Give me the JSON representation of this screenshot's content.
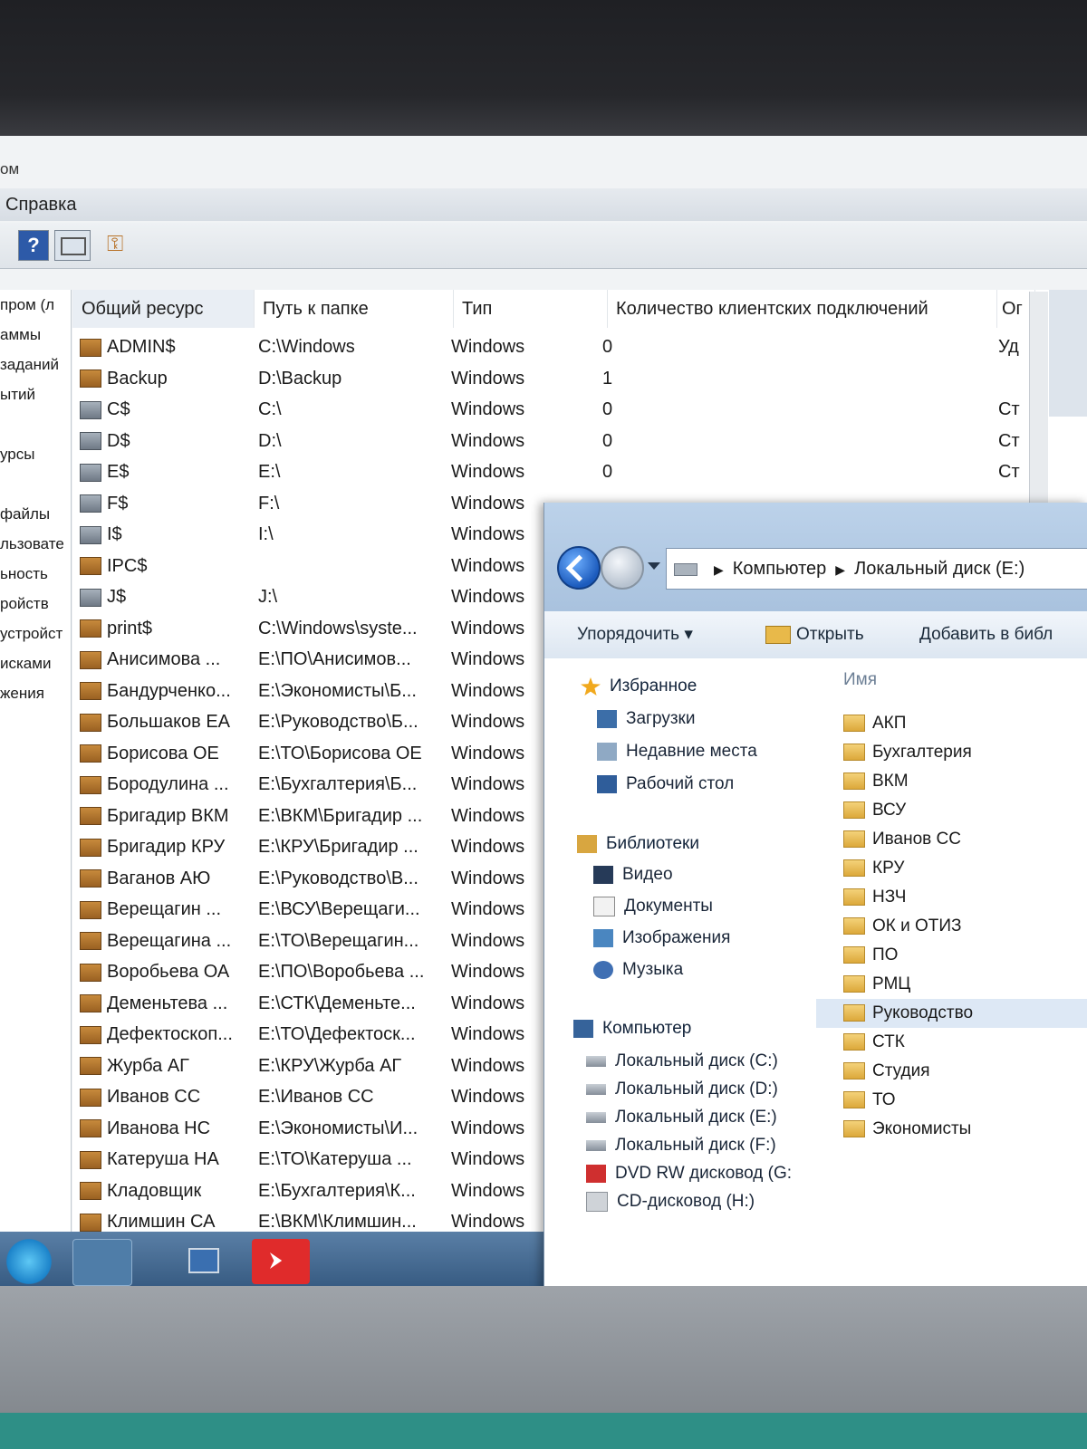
{
  "mmc": {
    "title_fragment": "ом",
    "menu_help": "Справка",
    "tree_items": [
      "пром (л",
      "аммы",
      "заданий",
      "ытий",
      "",
      "урсы",
      "",
      "файлы",
      "льзовате",
      "ьность",
      "ройств",
      "устройст",
      "исками",
      "жения"
    ],
    "columns": {
      "share": "Общий ресурс",
      "path": "Путь к папке",
      "type": "Тип",
      "clients": "Количество клиентских подключений",
      "desc": "Ог"
    },
    "rows": [
      {
        "name": "ADMIN$",
        "path": "C:\\Windows",
        "type": "Windows",
        "clients": "0",
        "desc": "Уд",
        "icon": "share-icon"
      },
      {
        "name": "Backup",
        "path": "D:\\Backup",
        "type": "Windows",
        "clients": "1",
        "desc": "",
        "icon": "share-icon"
      },
      {
        "name": "C$",
        "path": "C:\\",
        "type": "Windows",
        "clients": "0",
        "desc": "Ст",
        "icon": "drive-share-icon"
      },
      {
        "name": "D$",
        "path": "D:\\",
        "type": "Windows",
        "clients": "0",
        "desc": "Ст",
        "icon": "drive-share-icon"
      },
      {
        "name": "E$",
        "path": "E:\\",
        "type": "Windows",
        "clients": "0",
        "desc": "Ст",
        "icon": "drive-share-icon"
      },
      {
        "name": "F$",
        "path": "F:\\",
        "type": "Windows",
        "clients": "",
        "desc": "",
        "icon": "drive-share-icon"
      },
      {
        "name": "I$",
        "path": "I:\\",
        "type": "Windows",
        "clients": "",
        "desc": "",
        "icon": "drive-share-icon"
      },
      {
        "name": "IPC$",
        "path": "",
        "type": "Windows",
        "clients": "",
        "desc": "",
        "icon": "share-icon"
      },
      {
        "name": "J$",
        "path": "J:\\",
        "type": "Windows",
        "clients": "",
        "desc": "",
        "icon": "drive-share-icon"
      },
      {
        "name": "print$",
        "path": "C:\\Windows\\syste...",
        "type": "Windows",
        "clients": "",
        "desc": "",
        "icon": "share-icon"
      },
      {
        "name": "Анисимова ...",
        "path": "E:\\ПО\\Анисимов...",
        "type": "Windows",
        "clients": "",
        "desc": "",
        "icon": "share-icon"
      },
      {
        "name": "Бандурченко...",
        "path": "E:\\Экономисты\\Б...",
        "type": "Windows",
        "clients": "",
        "desc": "",
        "icon": "share-icon"
      },
      {
        "name": "Большаков ЕА",
        "path": "E:\\Руководство\\Б...",
        "type": "Windows",
        "clients": "",
        "desc": "",
        "icon": "share-icon"
      },
      {
        "name": "Борисова ОЕ",
        "path": "E:\\ТО\\Борисова ОЕ",
        "type": "Windows",
        "clients": "",
        "desc": "",
        "icon": "share-icon"
      },
      {
        "name": "Бородулина ...",
        "path": "E:\\Бухгалтерия\\Б...",
        "type": "Windows",
        "clients": "",
        "desc": "",
        "icon": "share-icon"
      },
      {
        "name": "Бригадир ВКМ",
        "path": "E:\\ВКМ\\Бригадир ...",
        "type": "Windows",
        "clients": "",
        "desc": "",
        "icon": "share-icon"
      },
      {
        "name": "Бригадир КРУ",
        "path": "E:\\КРУ\\Бригадир ...",
        "type": "Windows",
        "clients": "",
        "desc": "",
        "icon": "share-icon"
      },
      {
        "name": "Ваганов АЮ",
        "path": "E:\\Руководство\\В...",
        "type": "Windows",
        "clients": "",
        "desc": "",
        "icon": "share-icon"
      },
      {
        "name": "Верещагин ...",
        "path": "E:\\ВСУ\\Верещаги...",
        "type": "Windows",
        "clients": "",
        "desc": "",
        "icon": "share-icon"
      },
      {
        "name": "Верещагина ...",
        "path": "E:\\ТО\\Верещагин...",
        "type": "Windows",
        "clients": "",
        "desc": "",
        "icon": "share-icon"
      },
      {
        "name": "Воробьева ОА",
        "path": "E:\\ПО\\Воробьева ...",
        "type": "Windows",
        "clients": "",
        "desc": "",
        "icon": "share-icon"
      },
      {
        "name": "Деменьтева ...",
        "path": "E:\\СТК\\Деменьте...",
        "type": "Windows",
        "clients": "",
        "desc": "",
        "icon": "share-icon"
      },
      {
        "name": "Дефектоскоп...",
        "path": "E:\\ТО\\Дефектоск...",
        "type": "Windows",
        "clients": "",
        "desc": "",
        "icon": "share-icon"
      },
      {
        "name": "Журба АГ",
        "path": "E:\\КРУ\\Журба АГ",
        "type": "Windows",
        "clients": "",
        "desc": "",
        "icon": "share-icon"
      },
      {
        "name": "Иванов СС",
        "path": "E:\\Иванов СС",
        "type": "Windows",
        "clients": "",
        "desc": "",
        "icon": "share-icon"
      },
      {
        "name": "Иванова НС",
        "path": "E:\\Экономисты\\И...",
        "type": "Windows",
        "clients": "",
        "desc": "",
        "icon": "share-icon"
      },
      {
        "name": "Катеруша НА",
        "path": "E:\\ТО\\Катеруша ...",
        "type": "Windows",
        "clients": "",
        "desc": "",
        "icon": "share-icon"
      },
      {
        "name": "Кладовщик",
        "path": "E:\\Бухгалтерия\\К...",
        "type": "Windows",
        "clients": "",
        "desc": "",
        "icon": "share-icon"
      },
      {
        "name": "Климшин СА",
        "path": "E:\\ВКМ\\Климшин...",
        "type": "Windows",
        "clients": "",
        "desc": "",
        "icon": "share-icon"
      }
    ]
  },
  "explorer": {
    "address": {
      "computer": "Компьютер",
      "drive": "Локальный диск (E:)"
    },
    "commands": {
      "organize": "Упорядочить",
      "open": "Открыть",
      "add_to_library": "Добавить в библ"
    },
    "nav": {
      "favorites": "Избранное",
      "favorites_items": [
        "Загрузки",
        "Недавние места",
        "Рабочий стол"
      ],
      "libraries": "Библиотеки",
      "library_items": [
        "Видео",
        "Документы",
        "Изображения",
        "Музыка"
      ],
      "computer": "Компьютер",
      "computer_items": [
        "Локальный диск (C:)",
        "Локальный диск (D:)",
        "Локальный диск (E:)",
        "Локальный диск (F:)",
        "DVD RW дисковод (G:",
        "CD-дисковод (H:)"
      ]
    },
    "files_header": "Имя",
    "folders": [
      "АКП",
      "Бухгалтерия",
      "ВКМ",
      "ВСУ",
      "Иванов СС",
      "КРУ",
      "НЗЧ",
      "ОК и ОТИЗ",
      "ПО",
      "РМЦ",
      "Руководство",
      "СТК",
      "Студия",
      "ТО",
      "Экономисты"
    ],
    "selected_folder": "Руководство"
  }
}
